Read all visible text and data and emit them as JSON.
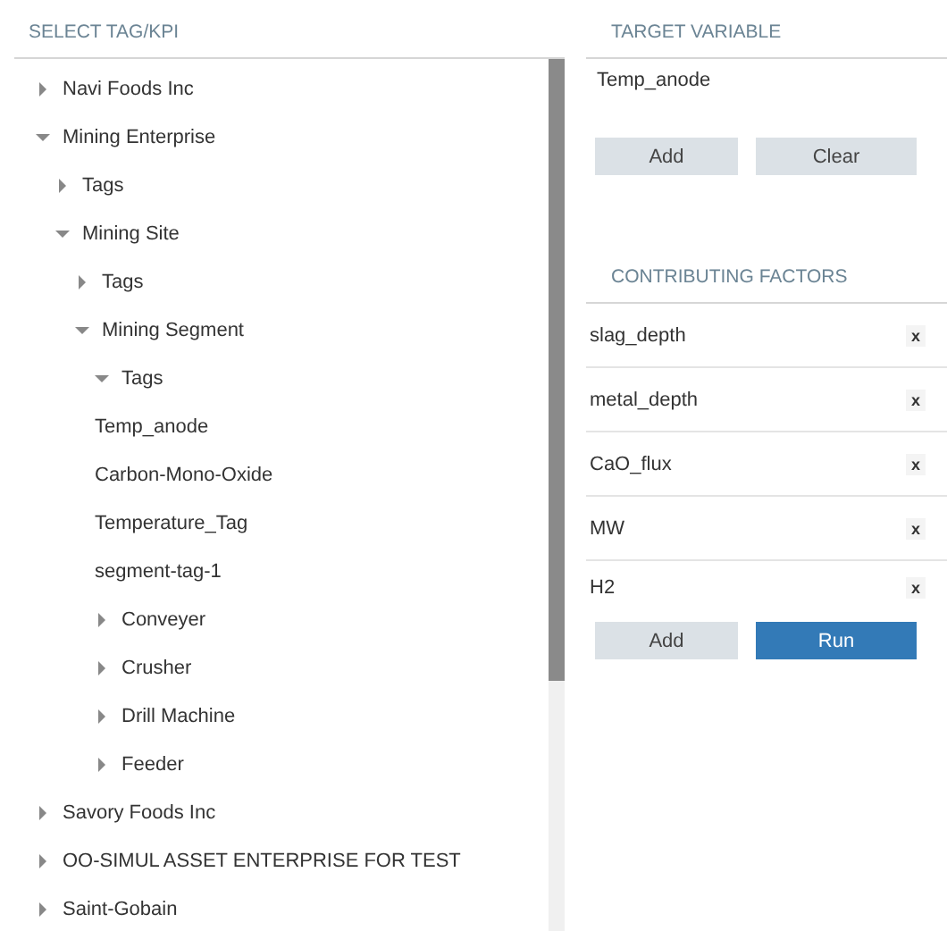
{
  "tag_panel": {
    "title": "SELECT TAG/KPI",
    "tree": [
      {
        "label": "Navi Foods Inc",
        "expanded": false
      },
      {
        "label": "Mining Enterprise",
        "expanded": true,
        "children": [
          {
            "label": "Tags",
            "expanded": false
          },
          {
            "label": "Mining Site",
            "expanded": true,
            "children": [
              {
                "label": "Tags",
                "expanded": false
              },
              {
                "label": "Mining Segment",
                "expanded": true,
                "children": [
                  {
                    "label": "Tags",
                    "expanded": true,
                    "children": [
                      {
                        "label": "Temp_anode",
                        "kind": "leaf"
                      },
                      {
                        "label": "Carbon-Mono-Oxide",
                        "kind": "leaf"
                      },
                      {
                        "label": "Temperature_Tag",
                        "kind": "leaf"
                      },
                      {
                        "label": "segment-tag-1",
                        "kind": "leaf"
                      }
                    ]
                  },
                  {
                    "label": "Conveyer",
                    "expanded": false
                  },
                  {
                    "label": "Crusher",
                    "expanded": false
                  },
                  {
                    "label": "Drill Machine",
                    "expanded": false
                  },
                  {
                    "label": "Feeder",
                    "expanded": false
                  }
                ]
              }
            ]
          }
        ]
      },
      {
        "label": "Savory Foods Inc",
        "expanded": false
      },
      {
        "label": "OO-SIMUL ASSET ENTERPRISE FOR TEST",
        "expanded": false
      },
      {
        "label": "Saint-Gobain",
        "expanded": false
      }
    ]
  },
  "target_variable": {
    "title": "TARGET VARIABLE",
    "value": "Temp_anode",
    "buttons": [
      "Add",
      "Clear"
    ]
  },
  "contributing_factors": {
    "title": "CONTRIBUTING FACTORS",
    "items": [
      {
        "label": "slag_depth",
        "remove": "x"
      },
      {
        "label": "metal_depth",
        "remove": "x"
      },
      {
        "label": "CaO_flux",
        "remove": "x"
      },
      {
        "label": "MW",
        "remove": "x"
      },
      {
        "label": "H2",
        "remove": "x"
      }
    ],
    "buttons": [
      {
        "label": "Add",
        "kind": "secondary"
      },
      {
        "label": "Run",
        "kind": "primary"
      }
    ]
  }
}
